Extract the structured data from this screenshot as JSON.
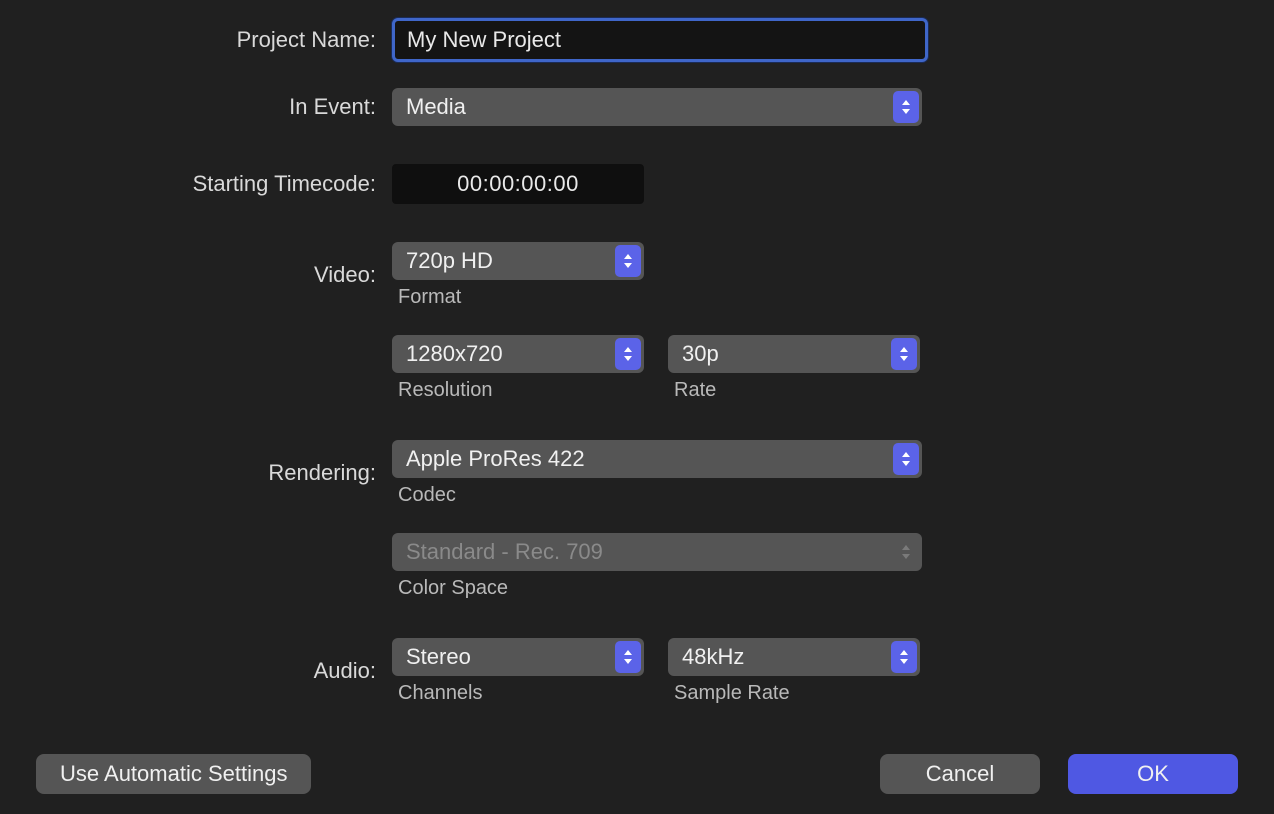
{
  "labels": {
    "project_name": "Project Name:",
    "in_event": "In Event:",
    "starting_tc": "Starting Timecode:",
    "video": "Video:",
    "rendering": "Rendering:",
    "audio": "Audio:"
  },
  "sub_labels": {
    "format": "Format",
    "resolution": "Resolution",
    "rate": "Rate",
    "codec": "Codec",
    "color_space": "Color Space",
    "channels": "Channels",
    "sample_rate": "Sample Rate"
  },
  "fields": {
    "project_name": "My New Project",
    "in_event": "Media",
    "starting_tc": "00:00:00:00",
    "video_format": "720p HD",
    "video_resolution": "1280x720",
    "video_rate": "30p",
    "render_codec": "Apple ProRes 422",
    "color_space": "Standard - Rec. 709",
    "audio_channels": "Stereo",
    "audio_sample_rate": "48kHz"
  },
  "buttons": {
    "auto": "Use Automatic Settings",
    "cancel": "Cancel",
    "ok": "OK"
  }
}
